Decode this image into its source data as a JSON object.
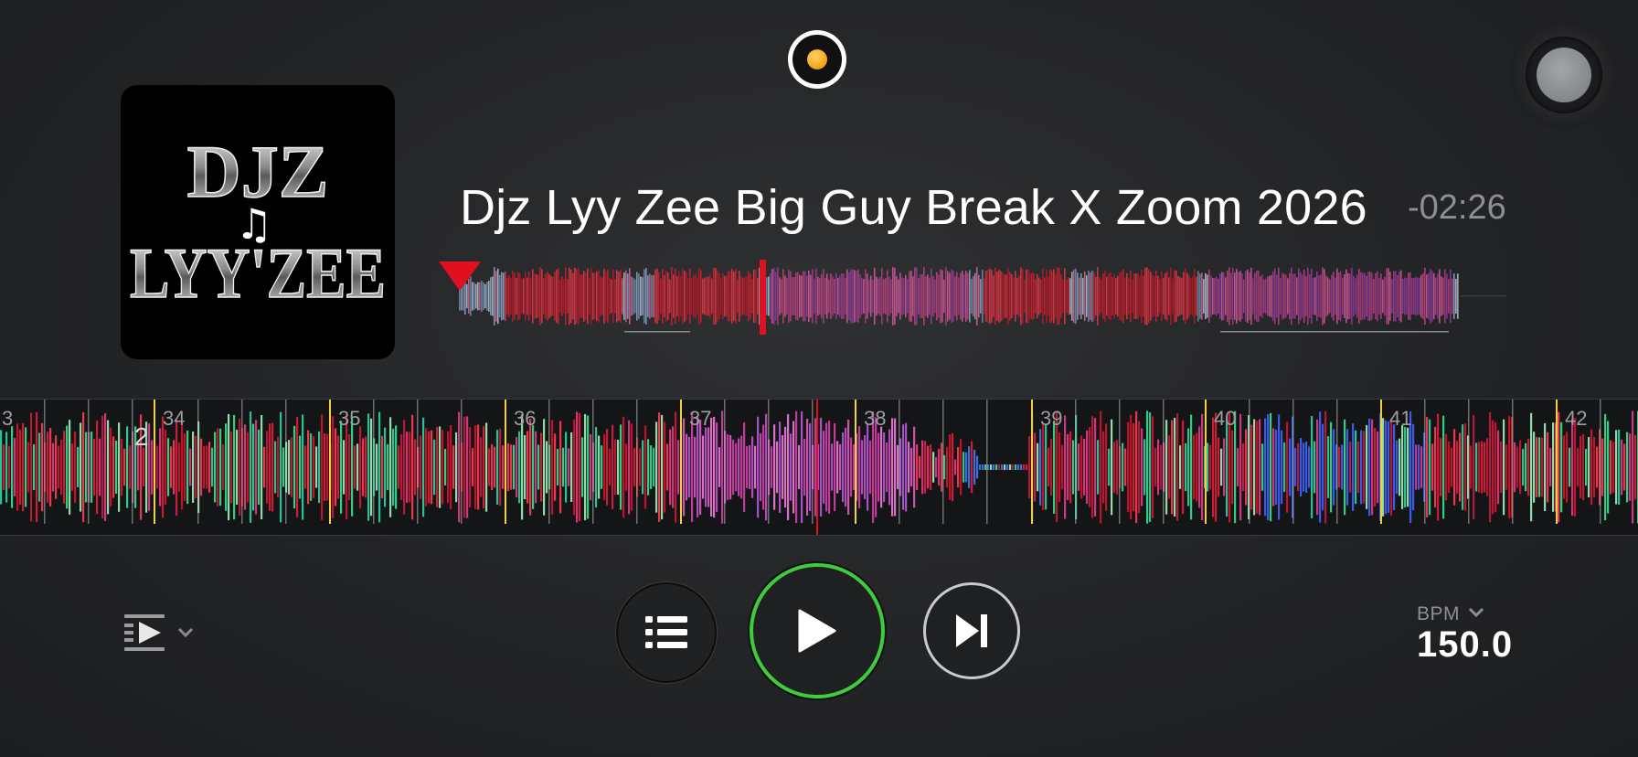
{
  "deck": {
    "track_title": "Djz Lyy Zee Big Guy Break X Zoom 2026",
    "remaining_time": "-02:26",
    "album_art": {
      "text_line1": "DJZ",
      "text_line2": "LYY'ZEE",
      "note_glyph": "♫"
    }
  },
  "waveform": {
    "bar_numbers": [
      "3",
      "34",
      "35",
      "36",
      "37",
      "38",
      "39",
      "40",
      "41",
      "42"
    ],
    "cue_marker": "2"
  },
  "controls": {
    "playlist_icon": "list-icon",
    "play_icon": "play-icon",
    "next_icon": "skip-next-icon",
    "mode_icon": "play-mode-icon"
  },
  "bpm": {
    "label": "BPM",
    "value": "150.0"
  },
  "colors": {
    "accent_green": "#3ecb3e",
    "record_dot": "#f3a10f",
    "playhead_red": "#e0101e",
    "beat_yellow": "#f1d040"
  }
}
